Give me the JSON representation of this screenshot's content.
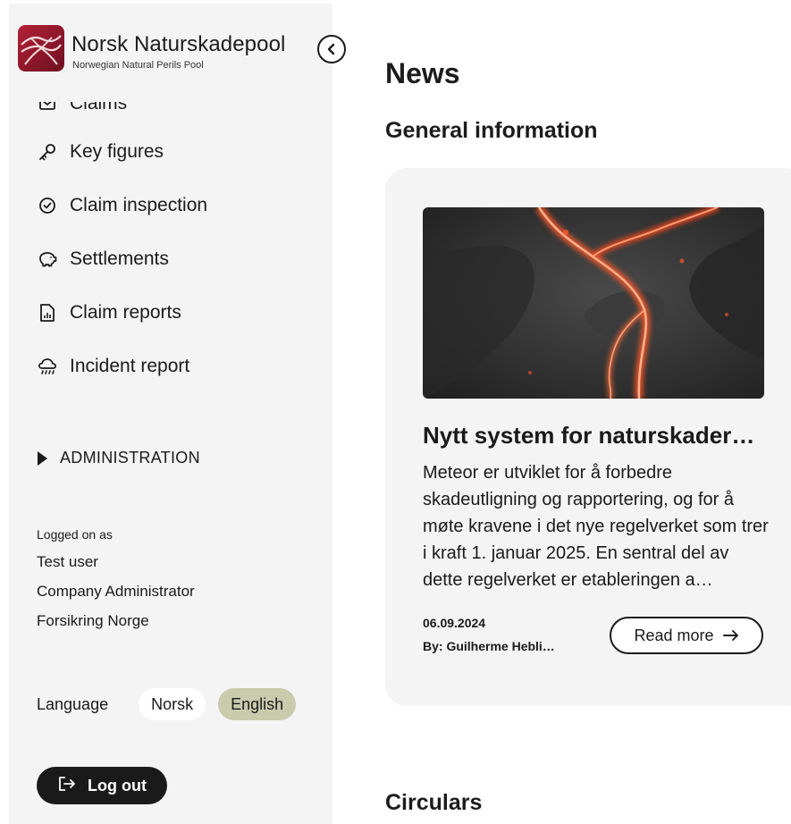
{
  "brand": {
    "name": "Norsk Naturskadepool",
    "subtitle": "Norwegian Natural Perils Pool"
  },
  "nav": {
    "items": [
      {
        "label": "Claims",
        "icon": "mail-icon"
      },
      {
        "label": "Key figures",
        "icon": "key-icon"
      },
      {
        "label": "Claim inspection",
        "icon": "check-circle-icon"
      },
      {
        "label": "Settlements",
        "icon": "piggy-bank-icon"
      },
      {
        "label": "Claim reports",
        "icon": "report-icon"
      },
      {
        "label": "Incident report",
        "icon": "rain-cloud-icon"
      }
    ],
    "admin_label": "ADMINISTRATION"
  },
  "user": {
    "logged_label": "Logged on as",
    "name": "Test user",
    "role": "Company Administrator",
    "company": "Forsikring Norge"
  },
  "language": {
    "label": "Language",
    "options": [
      "Norsk",
      "English"
    ],
    "selected": "English"
  },
  "logout_label": "Log out",
  "main": {
    "title": "News",
    "section_general": "General information",
    "section_circulars": "Circulars",
    "article": {
      "title": "Nytt system for naturskader…",
      "body": "Meteor er utviklet for å forbedre skadeutligning og rapportering, og for å møte kravene i det nye regelverket som trer i kraft 1. januar 2025. En sentral del av dette regelverket er etableringen a…",
      "date": "06.09.2024",
      "author": "By: Guilherme Hebli…",
      "read_more": "Read more"
    }
  },
  "colors": {
    "sidebar_bg": "#f4f4f4",
    "card_bg": "#f4f4f4",
    "selected_lang": "#c8ccad",
    "logout_bg": "#1a1a1a",
    "brand_red": "#8b1a2b"
  }
}
